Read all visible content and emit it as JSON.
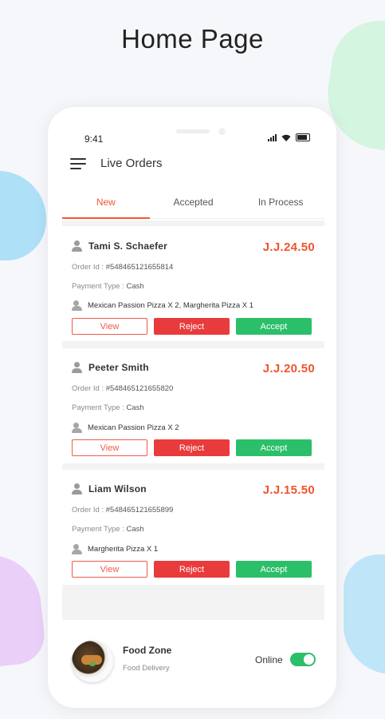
{
  "page": {
    "title": "Home Page"
  },
  "status_bar": {
    "time": "9:41"
  },
  "app": {
    "title": "Live Orders",
    "tabs": [
      {
        "label": "New",
        "active": true
      },
      {
        "label": "Accepted",
        "active": false
      },
      {
        "label": "In Process",
        "active": false
      }
    ]
  },
  "orders": [
    {
      "customer": "Tami S. Schaefer",
      "price": "J.J.24.50",
      "order_id_label": "Order Id :",
      "order_id": "#548465121655814",
      "payment_label": "Payment Type :",
      "payment": "Cash",
      "items": "Mexican Passion Pizza X 2, Margherita Pizza X 1",
      "view_label": "View",
      "reject_label": "Reject",
      "accept_label": "Accept"
    },
    {
      "customer": "Peeter Smith",
      "price": "J.J.20.50",
      "order_id_label": "Order Id :",
      "order_id": "#548465121655820",
      "payment_label": "Payment Type :",
      "payment": "Cash",
      "items": "Mexican Passion Pizza X 2",
      "view_label": "View",
      "reject_label": "Reject",
      "accept_label": "Accept"
    },
    {
      "customer": "Liam Wilson",
      "price": "J.J.15.50",
      "order_id_label": "Order Id :",
      "order_id": "#548465121655899",
      "payment_label": "Payment Type :",
      "payment": "Cash",
      "items": "Margherita Pizza X 1",
      "view_label": "View",
      "reject_label": "Reject",
      "accept_label": "Accept"
    }
  ],
  "footer": {
    "shop_name": "Food Zone",
    "shop_subtitle": "Food Delivery",
    "online_label": "Online",
    "online": true
  },
  "colors": {
    "accent": "#ef5a2e",
    "reject": "#e93b3b",
    "accept": "#2cbf6a"
  }
}
